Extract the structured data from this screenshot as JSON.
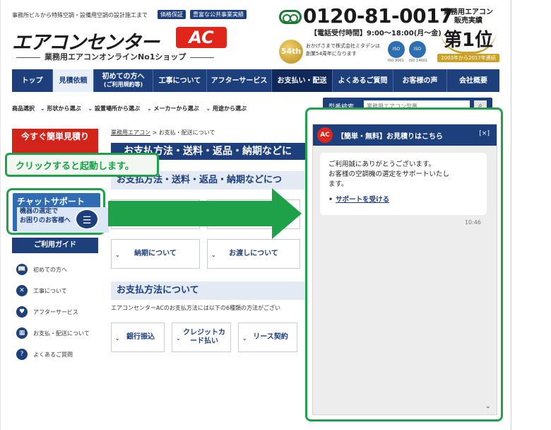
{
  "header": {
    "tagline": "事務所ビルから特殊空調・設備用空調の設計施工まで",
    "badges": [
      "価格保証",
      "豊富な公共事業実績"
    ],
    "logo_text": "エアコンセンター",
    "logo_ac": "AC",
    "logo_sub": "業務用エアコンオンラインNo1ショップ",
    "phone": "0120-81-0017",
    "hours": "【電話受付時間】9:00～18:00(月～金)",
    "anniversary_badge": "54th",
    "anniversary_text_1": "おかげさまで株式会社ミタデンは",
    "anniversary_text_2": "創業54周年になります",
    "iso": [
      {
        "mark": "ISO",
        "label": "ISO 9001"
      },
      {
        "mark": "ISO",
        "label": "ISO 14001"
      }
    ],
    "award_line1": "業務用エアコン",
    "award_line2": "販売実績",
    "award_rank": "第1位",
    "award_period": "2003年から2017年連続"
  },
  "gnav": [
    {
      "label": "トップ",
      "style": ""
    },
    {
      "label": "見積依頼",
      "style": "light"
    },
    {
      "label": "初めての方へ",
      "sub": "(ご利用規約等)",
      "style": ""
    },
    {
      "label": "工事について",
      "style": ""
    },
    {
      "label": "アフターサービス",
      "style": ""
    },
    {
      "label": "お支払い・配送",
      "style": "dark"
    },
    {
      "label": "よくあるご質問",
      "style": ""
    },
    {
      "label": "お客様の声",
      "style": ""
    },
    {
      "label": "会社概要",
      "style": ""
    }
  ],
  "subnav": {
    "lead": "商品選択",
    "items": [
      "形状から選ぶ",
      "設置場所から選ぶ",
      "メーカーから選ぶ",
      "用途から選ぶ"
    ]
  },
  "search": {
    "label": "型番検索",
    "placeholder": "業務用エアコン型番",
    "button_icon": "search-icon"
  },
  "sidebar": {
    "quote_button": "今すぐ簡単見積り",
    "chat_support_title": "チャットサポート",
    "chat_support_line1": "機器の選定で",
    "chat_support_line2": "お困りのお客様へ",
    "guide_title": "ご利用ガイド",
    "guide_items": [
      {
        "label": "初めての方へ",
        "icon": "book-icon",
        "glyph": "📖"
      },
      {
        "label": "工事について",
        "icon": "tools-icon",
        "glyph": "✕"
      },
      {
        "label": "アフターサービス",
        "icon": "heart-icon",
        "glyph": "♥"
      },
      {
        "label": "お支払・配送について",
        "icon": "calculator-icon",
        "glyph": "▦"
      },
      {
        "label": "よくあるご質問",
        "icon": "question-icon",
        "glyph": "?"
      }
    ]
  },
  "callout": {
    "text": "クリックすると起動します。"
  },
  "main": {
    "breadcrumb_home": "業務用エアコン",
    "breadcrumb_sep": ">",
    "breadcrumb_current": "お支払・配送について",
    "page_title": "お支払方法・送料・返品・納期などに",
    "section1": "お支払方法・送料・返品・納期などにつ",
    "row1": [
      "",
      ""
    ],
    "row2": [
      "納期について",
      "お渡しについて"
    ],
    "section2": "お支払方法について",
    "pay_desc": "エアコンセンターACのお支払方法には以下の6種類の方法がござい",
    "pay_buttons": [
      "銀行振込",
      "クレジットカード払い",
      "リース契約"
    ]
  },
  "chat": {
    "logo": "AC",
    "title": "【簡単・無料】お見積りはこちら",
    "close": "[×]",
    "lines": [
      "ご利用誠にありがとうございます。",
      "お客様の空調機の選定をサポートいたし",
      "ます。"
    ],
    "link": "サポートを受ける",
    "time": "10:46"
  },
  "colors": {
    "navy": "#1d3f7c",
    "red": "#d3241c",
    "green": "#1fa34a"
  }
}
